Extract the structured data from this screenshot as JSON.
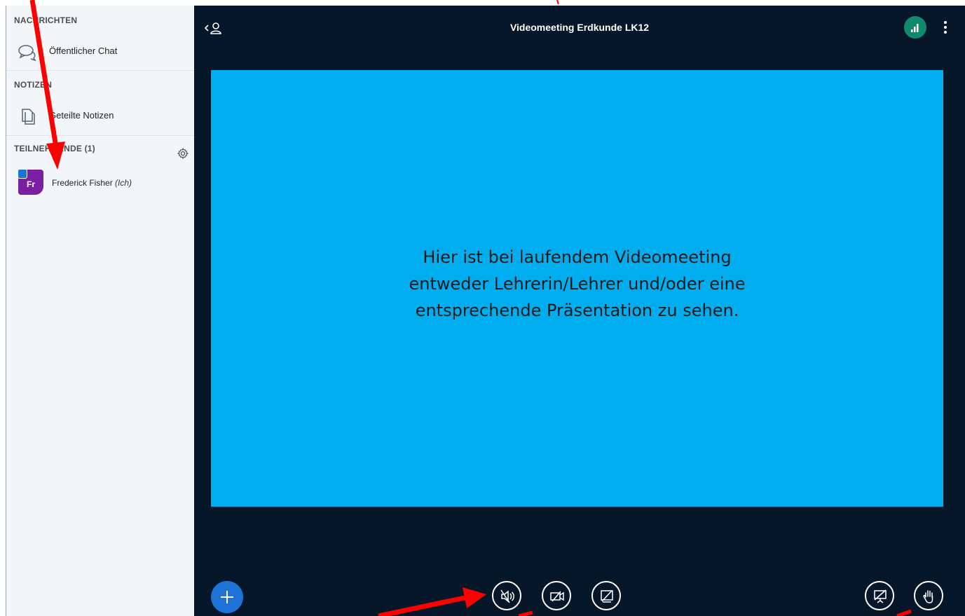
{
  "sidebar": {
    "messages_title": "NACHRICHTEN",
    "public_chat": "Öffentlicher Chat",
    "notes_title": "NOTIZEN",
    "shared_notes": "Geteilte Notizen",
    "participants_title": "TEILNEHMENDE (1)",
    "users": [
      {
        "initials": "Fr",
        "name": "Frederick Fisher",
        "me_suffix": "(Ich)",
        "avatar_color": "#7b1fa2"
      }
    ]
  },
  "header": {
    "title": "Videomeeting Erdkunde LK12"
  },
  "presentation": {
    "lines": [
      "Hier ist bei laufendem Videomeeting",
      "entweder Lehrerin/Lehrer und/oder eine",
      "entsprechende Präsentation zu sehen."
    ]
  },
  "colors": {
    "accent": "#00aeef",
    "bg": "#06172a",
    "plus": "#1f73d8",
    "arrow": "#ff0000",
    "connection": "#0f8a6c"
  },
  "icons": [
    "user-list-toggle-icon",
    "chat-icon",
    "notes-icon",
    "gear-icon",
    "connection-status-icon",
    "more-options-icon",
    "plus-icon",
    "audio-icon",
    "camera-off-icon",
    "screen-share-off-icon",
    "presentation-off-icon",
    "raise-hand-icon"
  ]
}
